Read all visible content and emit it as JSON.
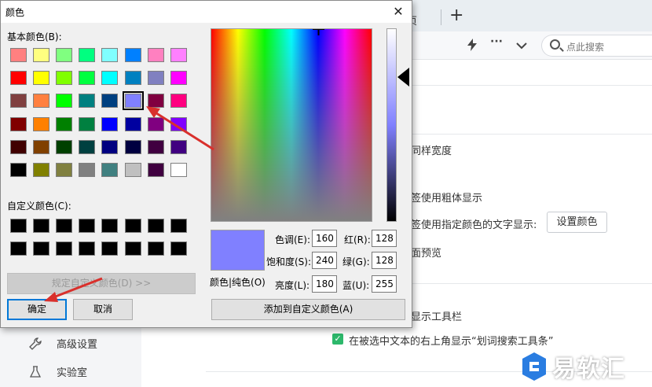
{
  "background": {
    "tab_fragment": "页",
    "new_tab": "+",
    "search_placeholder": "点此搜索",
    "toolbar_icons": [
      "lightning-icon",
      "more-icon",
      "chevron-down-icon"
    ],
    "settings_lines": [
      "同样宽度",
      "签使用粗体显示",
      "签使用指定颜色的文字显示:",
      "面预览",
      "显示工具栏"
    ],
    "set_color_button": "设置颜色",
    "checkbox_label": "在被选中文本的右上角显示“划词搜索工具条”",
    "nav_items": [
      {
        "icon": "wrench-icon",
        "label": "高级设置"
      },
      {
        "icon": "flask-icon",
        "label": "实验室"
      }
    ],
    "watermark": "易软汇",
    "accent_color": "#2db86b"
  },
  "dialog": {
    "title": "颜色",
    "close_icon": "close-icon",
    "basic_colors_label": "基本颜色(B):",
    "basic_colors": [
      [
        "#ff8080",
        "#ffff80",
        "#80ff80",
        "#00ff80",
        "#80ffff",
        "#0080ff",
        "#ff80c0",
        "#ff80ff"
      ],
      [
        "#ff0000",
        "#ffff00",
        "#80ff00",
        "#00ff40",
        "#00ffff",
        "#0080c0",
        "#8080c0",
        "#ff00ff"
      ],
      [
        "#804040",
        "#ff8040",
        "#00ff00",
        "#008080",
        "#004080",
        "#8080ff",
        "#800040",
        "#ff0080"
      ],
      [
        "#800000",
        "#ff8000",
        "#008000",
        "#008040",
        "#0000ff",
        "#0000a0",
        "#800080",
        "#8000ff"
      ],
      [
        "#400000",
        "#804000",
        "#004000",
        "#004040",
        "#000080",
        "#000040",
        "#400040",
        "#400080"
      ],
      [
        "#000000",
        "#808000",
        "#808040",
        "#808080",
        "#408080",
        "#c0c0c0",
        "#400040",
        "#ffffff"
      ]
    ],
    "selected_basic": {
      "row": 2,
      "col": 5
    },
    "custom_colors_label": "自定义颜色(C):",
    "custom_colors": [
      "#000000",
      "#000000",
      "#000000",
      "#000000",
      "#000000",
      "#000000",
      "#000000",
      "#000000",
      "#000000",
      "#000000",
      "#000000",
      "#000000",
      "#000000",
      "#000000",
      "#000000",
      "#000000"
    ],
    "define_custom_button": "规定自定义颜色(D) >>",
    "ok_button": "确定",
    "cancel_button": "取消",
    "preview_label": "颜色|纯色(O)",
    "preview_color": "#8080ff",
    "hue_label": "色调(E):",
    "hue_value": "160",
    "sat_label": "饱和度(S):",
    "sat_value": "240",
    "lum_label": "亮度(L):",
    "lum_value": "180",
    "red_label": "红(R):",
    "red_value": "128",
    "green_label": "绿(G):",
    "green_value": "128",
    "blue_label": "蓝(U):",
    "blue_value": "255",
    "add_custom_button": "添加到自定义颜色(A)"
  },
  "annotation_color": "#d9302c"
}
